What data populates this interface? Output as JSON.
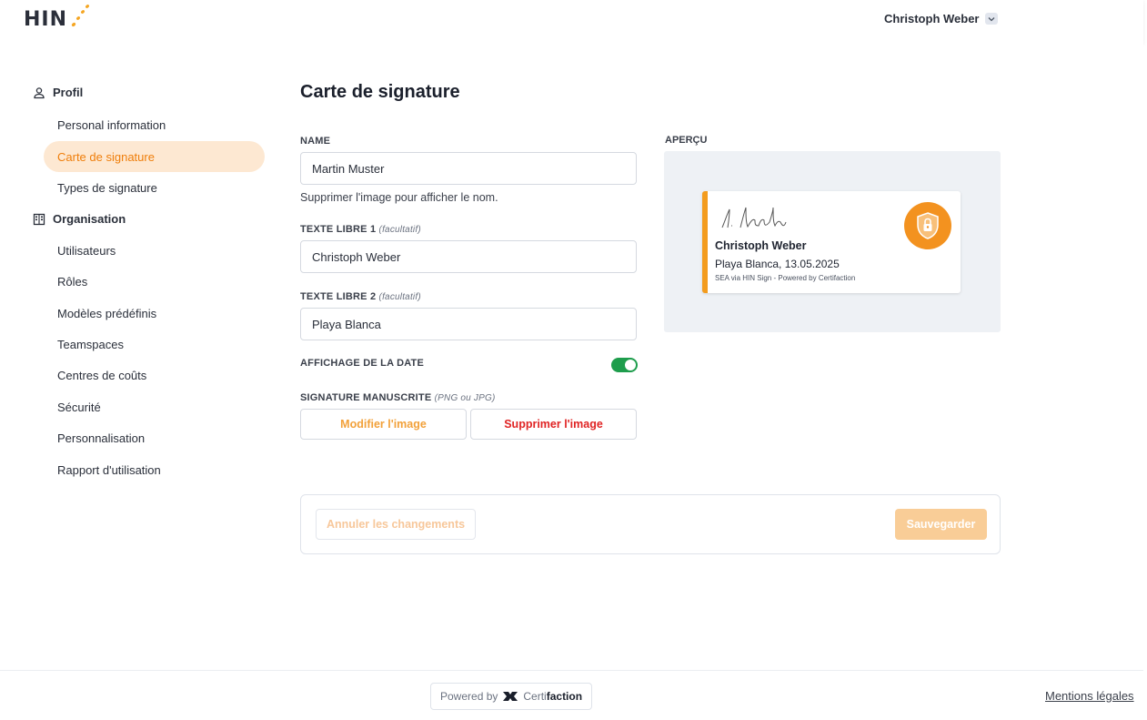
{
  "header": {
    "logo_text": "HIN",
    "user_name": "Christoph Weber"
  },
  "sidebar": {
    "sections": [
      {
        "label": "Profil",
        "icon": "user-icon"
      },
      {
        "label": "Organisation",
        "icon": "building-icon"
      }
    ],
    "profile_items": [
      {
        "label": "Personal information",
        "active": false
      },
      {
        "label": "Carte de signature",
        "active": true
      },
      {
        "label": "Types de signature",
        "active": false
      }
    ],
    "org_items": [
      {
        "label": "Utilisateurs"
      },
      {
        "label": "Rôles"
      },
      {
        "label": "Modèles prédéfinis"
      },
      {
        "label": "Teamspaces"
      },
      {
        "label": "Centres de coûts"
      },
      {
        "label": "Sécurité"
      },
      {
        "label": "Personnalisation"
      },
      {
        "label": "Rapport d'utilisation"
      }
    ]
  },
  "form": {
    "title": "Carte de signature",
    "name_label": "NAME",
    "name_value": "Martin Muster",
    "name_hint": "Supprimer l'image pour afficher le nom.",
    "free1_label": "TEXTE LIBRE 1",
    "free1_optional": "(facultatif)",
    "free1_value": "Christoph Weber",
    "free2_label": "TEXTE LIBRE 2",
    "free2_optional": "(facultatif)",
    "free2_value": "Playa Blanca",
    "date_label": "AFFICHAGE DE LA DATE",
    "date_enabled": true,
    "handwritten_label": "SIGNATURE MANUSCRITE",
    "handwritten_formats": "(PNG ou JPG)",
    "modify_button": "Modifier l'image",
    "delete_button": "Supprimer l'image"
  },
  "preview": {
    "label": "APERÇU",
    "name": "Christoph Weber",
    "place_date": "Playa Blanca, 13.05.2025",
    "note": "SEA via HIN Sign - Powered by Certifaction",
    "badge_icon": "shield-lock-icon"
  },
  "actions": {
    "cancel_label": "Annuler les changements",
    "save_label": "Sauvegarder"
  },
  "footer": {
    "powered_prefix": "Powered by",
    "brand_light": "Certi",
    "brand_bold": "faction",
    "legal_link": "Mentions légales"
  },
  "colors": {
    "accent": "#ef7e0b",
    "active_bg": "#fde8d2",
    "toggle_on": "#1e9d4c",
    "danger": "#e02424"
  }
}
